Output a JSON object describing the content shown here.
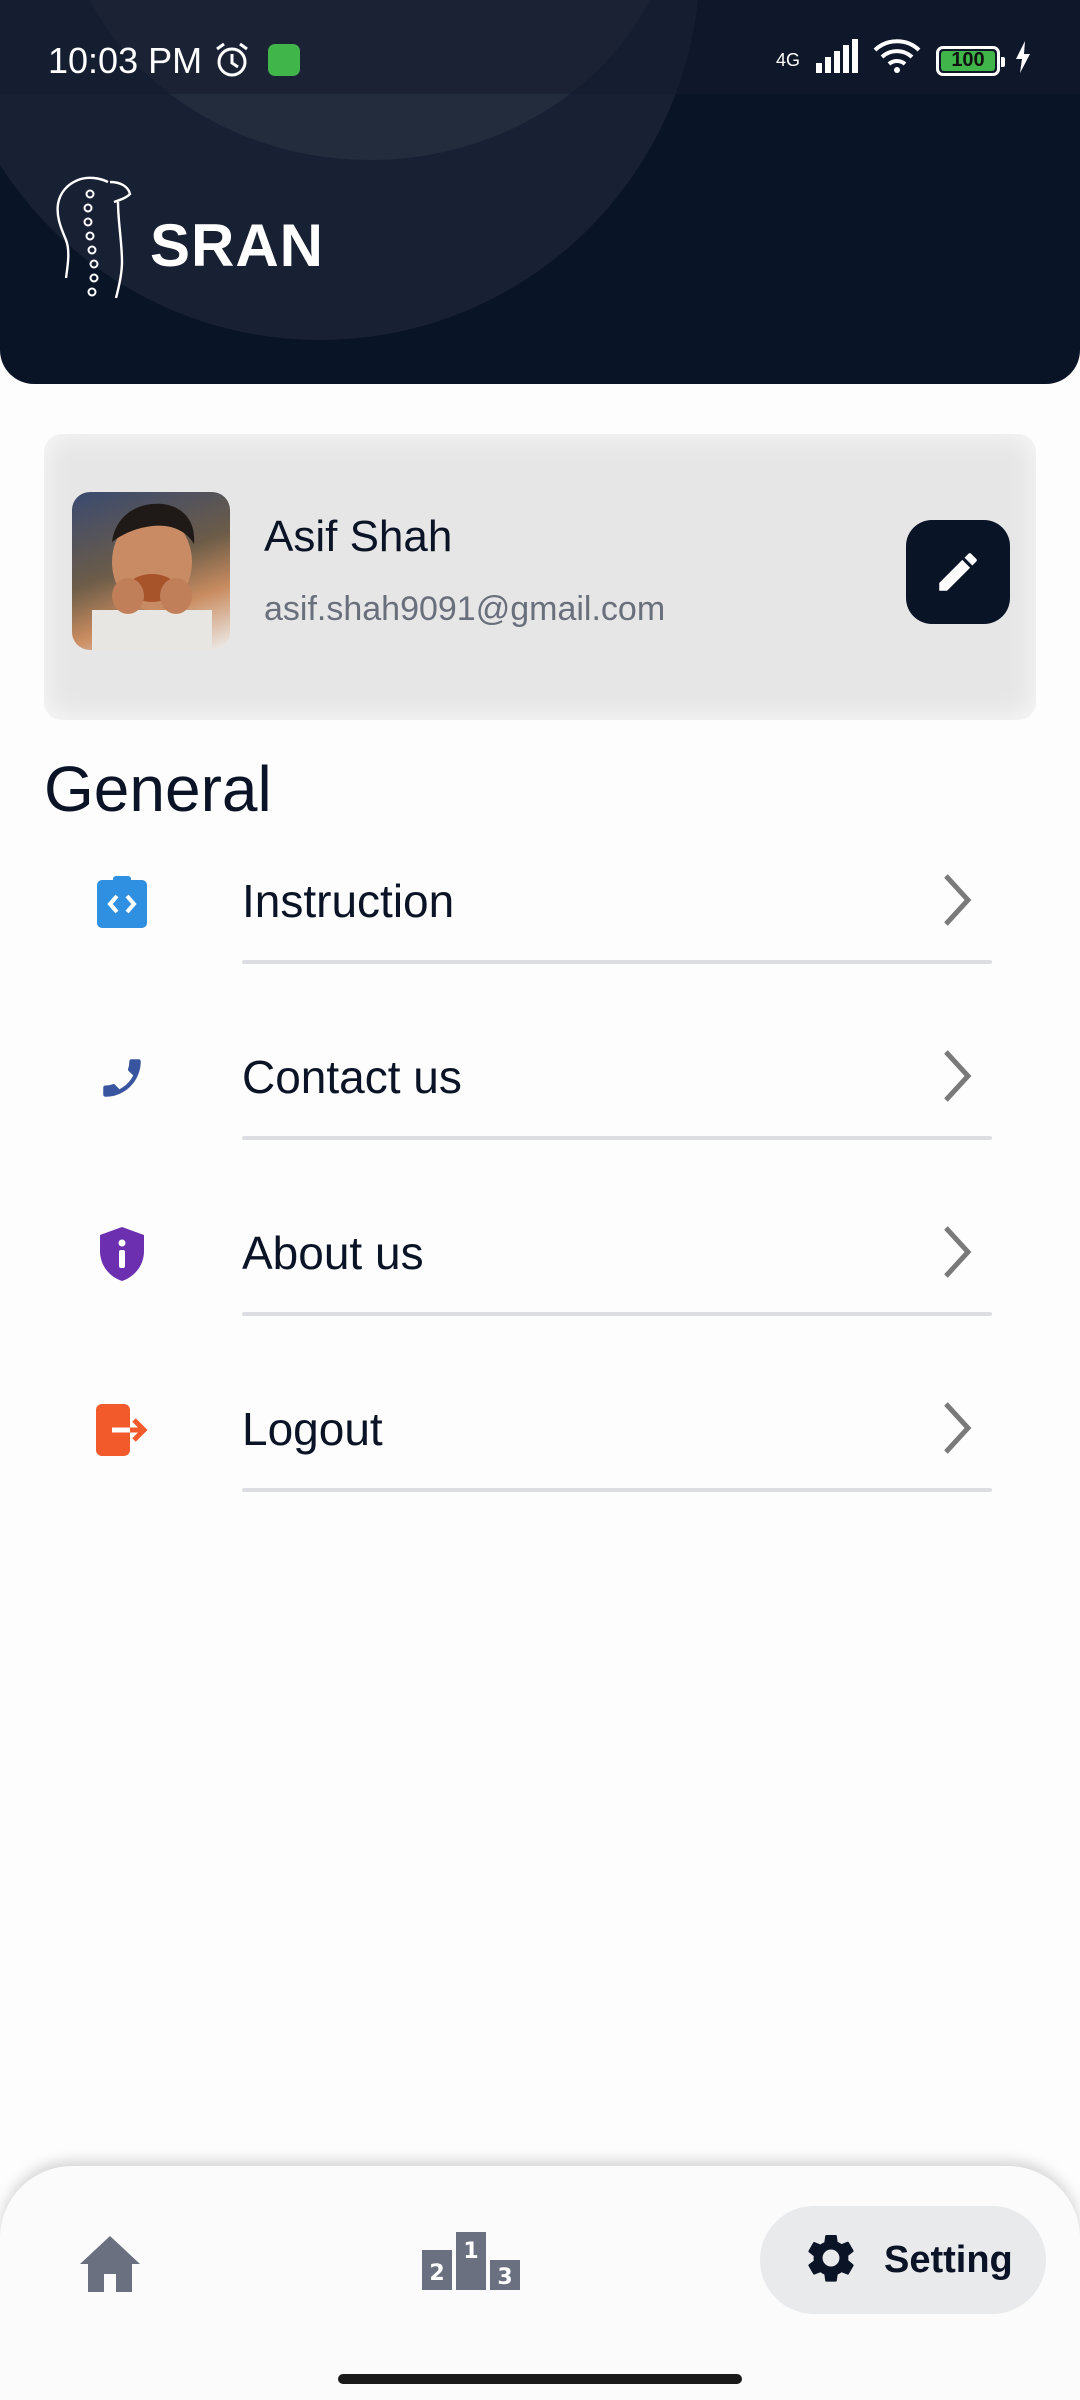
{
  "status_bar": {
    "time": "10:03 PM",
    "network": "4G",
    "battery": "100"
  },
  "header": {
    "logo_text": "SRAN"
  },
  "profile": {
    "name": "Asif Shah",
    "email": "asif.shah9091@gmail.com"
  },
  "section": {
    "title": "General"
  },
  "menu": {
    "items": [
      {
        "label": "Instruction",
        "icon": "instruction-icon",
        "color": "#2f8fe0"
      },
      {
        "label": "Contact us",
        "icon": "phone-icon",
        "color": "#3a55a0"
      },
      {
        "label": "About us",
        "icon": "shield-info-icon",
        "color": "#6b2fb0"
      },
      {
        "label": "Logout",
        "icon": "logout-icon",
        "color": "#f25a2c"
      }
    ]
  },
  "bottom_nav": {
    "setting_label": "Setting",
    "active_tab": "Setting"
  },
  "colors": {
    "header_bg": "#0a1427",
    "accent_dark": "#0a1427"
  }
}
